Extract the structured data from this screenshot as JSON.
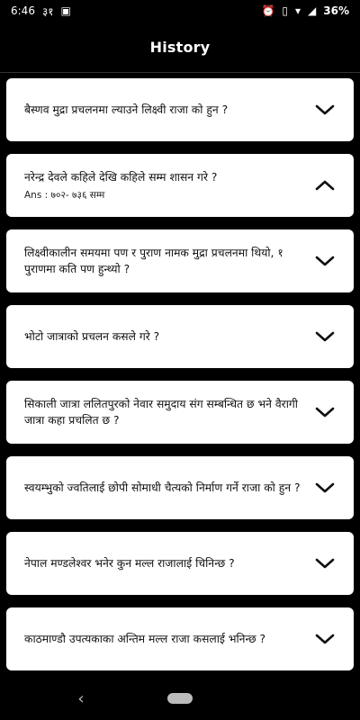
{
  "status": {
    "time": "6:46",
    "indicator": "३१",
    "icons": [
      "image-icon",
      "alarm-icon",
      "vibrate-icon",
      "wifi-icon",
      "signal-icon"
    ],
    "battery_percent": "36%"
  },
  "appbar": {
    "title": "History"
  },
  "items": [
    {
      "question": "बैस्णव मुद्रा प्रचलनमा ल्याउने लिक्ष्वी राजा को हुन ?",
      "expanded": false
    },
    {
      "question": " नरेन्द्र देवले कहिले देखि कहिले सम्म शासन गरे ?",
      "answer": "Ans : ७०२- ७३६ सम्म",
      "expanded": true
    },
    {
      "question": "लिक्ष्वीकालीन समयमा पण र पुराण नामक मुद्रा प्रचलनमा थियो, १ पुराणमा कति पण हुन्थ्यो ?",
      "expanded": false
    },
    {
      "question": "भोटो जात्राको प्रचलन कसले गरे ?",
      "expanded": false
    },
    {
      "question": "सिकाली जात्रा ललितपुरको नेवार समुदाय संग सम्बन्धित छ भने वैरागी जात्रा कहा प्रचलित छ ?",
      "expanded": false
    },
    {
      "question": "स्वयम्भुको ज्वतिलाई छोपी सोमाधी चैत्यको निर्माण गर्ने राजा को हुन ?",
      "expanded": false
    },
    {
      "question": "नेपाल मण्डलेश्वर भनेर कुन मल्ल राजालाई चिनिन्छ ?",
      "expanded": false
    },
    {
      "question": "काठमाण्डौ उपत्यकाका अन्तिम मल्ल राजा कसलाई भनिन्छ ?",
      "expanded": false
    }
  ],
  "navbar": {
    "back_icon": "back-icon",
    "home_icon": "home-pill-icon"
  }
}
